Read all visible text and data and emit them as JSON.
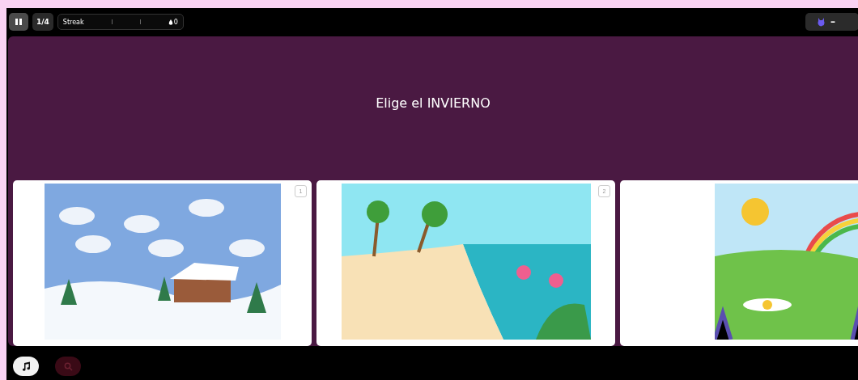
{
  "top_bar": {
    "page_counter": "1/4",
    "streak": {
      "label": "Streak",
      "count": "0"
    },
    "right_button": {
      "text": "–"
    }
  },
  "question": "Elige el INVIERNO",
  "options": [
    {
      "kind": "winter",
      "number": "1"
    },
    {
      "kind": "beach",
      "number": "2"
    },
    {
      "kind": "spring"
    }
  ],
  "bottom_bar": {
    "music_on": true,
    "zoom_disabled": true
  }
}
